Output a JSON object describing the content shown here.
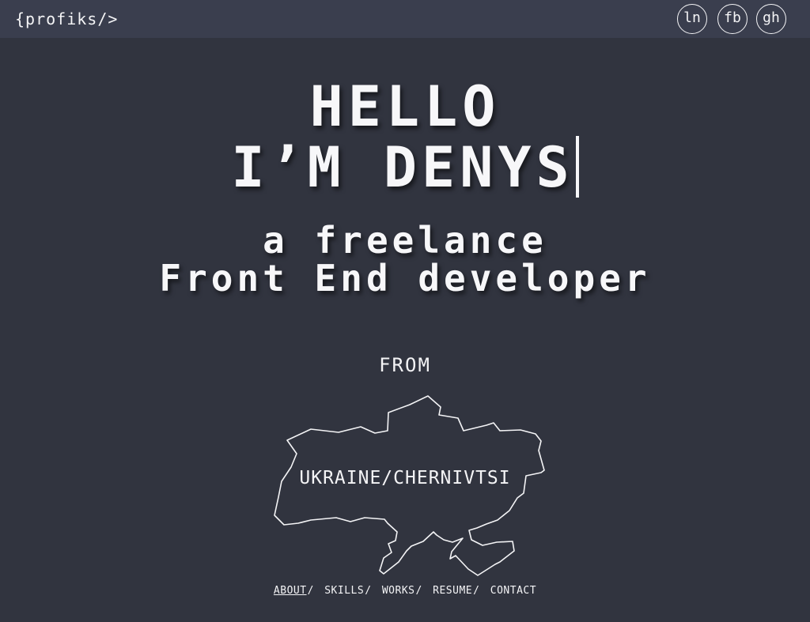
{
  "header": {
    "logo": "{profiks/>",
    "social": [
      {
        "label": "ln"
      },
      {
        "label": "fb"
      },
      {
        "label": "gh"
      }
    ]
  },
  "hero": {
    "line1": "HELLO",
    "line2": "I’M DENYS",
    "sub1": "a freelance",
    "sub2": "Front End developer"
  },
  "location": {
    "from": "FROM",
    "place": "UKRAINE/CHERNIVTSI"
  },
  "nav": {
    "items": [
      "ABOUT",
      "SKILLS",
      "WORKS",
      "RESUME",
      "CONTACT"
    ],
    "separator": "/",
    "active": "ABOUT"
  },
  "colors": {
    "background": "#31343f",
    "topbar": "#3a3e4e",
    "text": "#f4f4f6"
  }
}
